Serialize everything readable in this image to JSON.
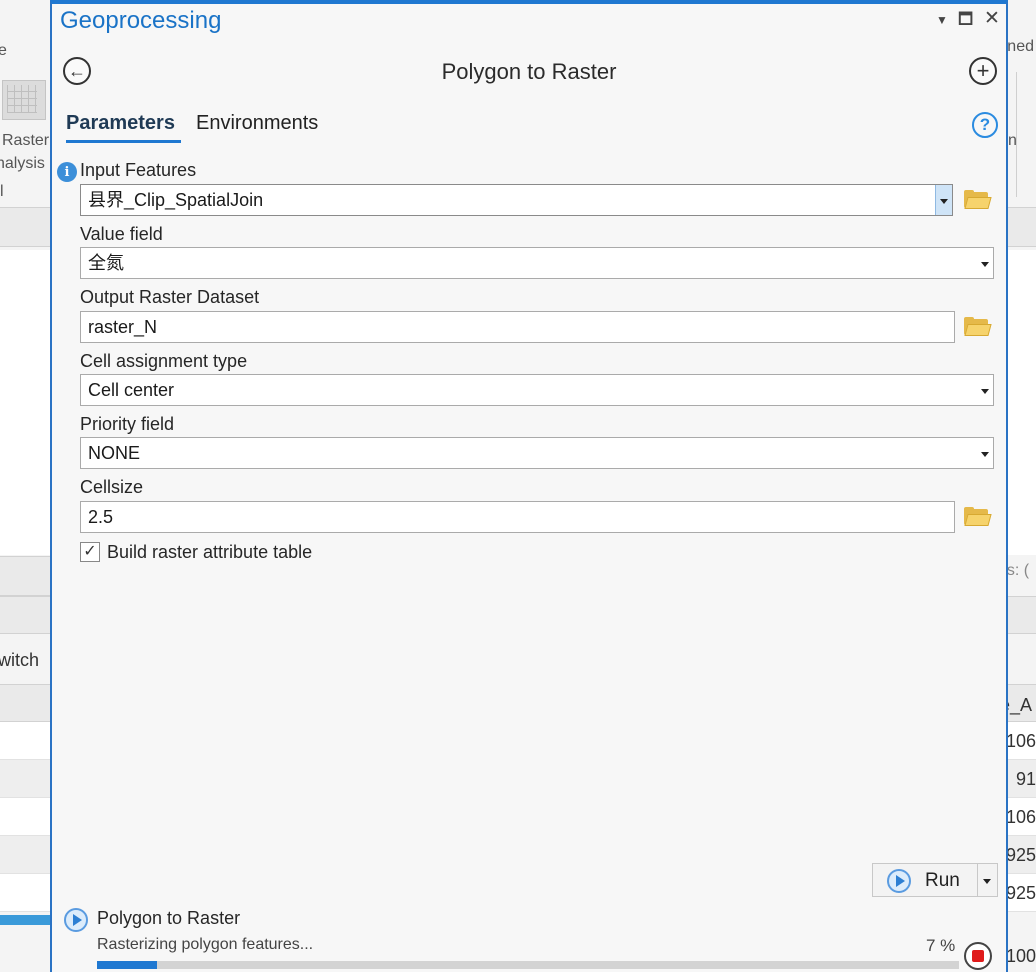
{
  "background": {
    "left_fragments": [
      "e",
      "Raster",
      "nalysis",
      "l",
      "witch"
    ],
    "right_fragments": [
      "ned",
      "n",
      "es: (",
      "e_A"
    ],
    "right_values": [
      "106",
      "91",
      "106",
      "925",
      "925",
      "100"
    ]
  },
  "pane": {
    "title": "Geoprocessing",
    "tool_title": "Polygon to Raster",
    "tabs": [
      {
        "label": "Parameters",
        "active": true
      },
      {
        "label": "Environments",
        "active": false
      }
    ],
    "help_glyph": "?"
  },
  "params": {
    "input_features": {
      "label": "Input Features",
      "value": "县界_Clip_SpatialJoin"
    },
    "value_field": {
      "label": "Value field",
      "value": "全氮"
    },
    "output_raster": {
      "label": "Output Raster Dataset",
      "value": "raster_N"
    },
    "cell_assignment": {
      "label": "Cell assignment type",
      "value": "Cell center"
    },
    "priority_field": {
      "label": "Priority field",
      "value": "NONE"
    },
    "cellsize": {
      "label": "Cellsize",
      "value": "2.5"
    },
    "build_rat": {
      "label": "Build raster attribute table",
      "checked": true
    }
  },
  "run": {
    "label": "Run"
  },
  "progress": {
    "tool": "Polygon to Raster",
    "status": "Rasterizing polygon features...",
    "percent_text": "7 %",
    "percent": 7
  },
  "colors": {
    "accent": "#1f78d1",
    "title": "#1a73c7",
    "folder": "#e5b94a",
    "stop": "#e01b1b"
  }
}
